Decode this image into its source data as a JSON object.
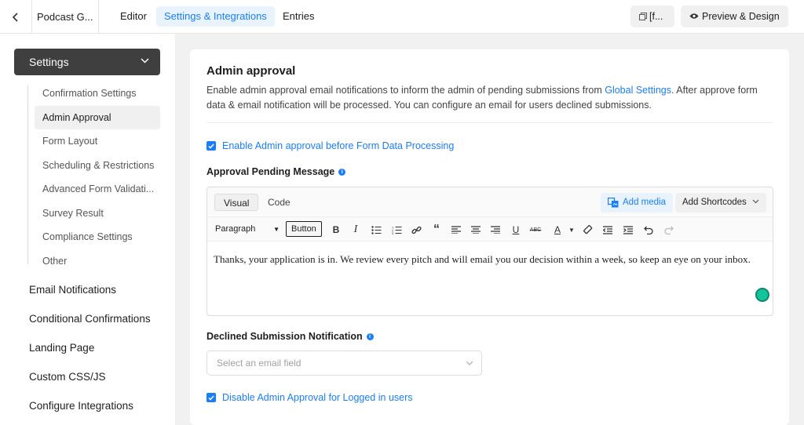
{
  "topbar": {
    "back_icon": "chevron-left-icon",
    "form_name": "Podcast G...",
    "tabs": [
      {
        "label": "Editor"
      },
      {
        "label": "Settings & Integrations",
        "active": true
      },
      {
        "label": "Entries"
      }
    ],
    "shortcode_label": "[f...",
    "preview_label": "Preview & Design"
  },
  "sidebar": {
    "header": "Settings",
    "sub_items": [
      {
        "label": "Confirmation Settings"
      },
      {
        "label": "Admin Approval",
        "active": true
      },
      {
        "label": "Form Layout"
      },
      {
        "label": "Scheduling & Restrictions"
      },
      {
        "label": "Advanced Form Validati..."
      },
      {
        "label": "Survey Result"
      },
      {
        "label": "Compliance Settings"
      },
      {
        "label": "Other"
      }
    ],
    "main_items": [
      {
        "label": "Email Notifications"
      },
      {
        "label": "Conditional Confirmations"
      },
      {
        "label": "Landing Page"
      },
      {
        "label": "Custom CSS/JS"
      },
      {
        "label": "Configure Integrations"
      }
    ]
  },
  "card": {
    "title": "Admin approval",
    "desc_before_link": "Enable admin approval email notifications to inform the admin of pending submissions from ",
    "desc_link": "Global Settings",
    "desc_after_link": ". After approve form data & email notification will be processed. You can configure an email for users declined submissions.",
    "enable_checkbox_label": "Enable Admin approval before Form Data Processing",
    "enable_checked": true,
    "pending_label": "Approval Pending Message",
    "editor": {
      "tab_visual": "Visual",
      "tab_code": "Code",
      "add_media": "Add media",
      "add_shortcodes": "Add Shortcodes",
      "paragraph": "Paragraph",
      "button": "Button",
      "content": "Thanks, your application is in. We review every pitch and will email you our decision within a week, so keep an eye on your inbox."
    },
    "declined_label": "Declined Submission Notification",
    "select_placeholder": "Select an email field",
    "disable_checkbox_label": "Disable Admin Approval for Logged in users",
    "disable_checked": true
  },
  "colors": {
    "accent": "#1a7efb",
    "sidebar_active": "#3f3f3f"
  }
}
